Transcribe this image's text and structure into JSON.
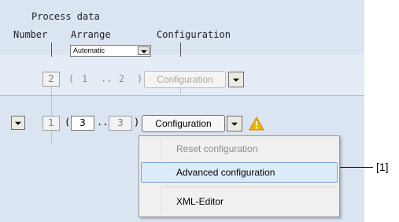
{
  "header": {
    "process_data": "Process data",
    "number": "Number",
    "arrange": "Arrange",
    "configuration": "Configuration"
  },
  "arrange_select": {
    "value": "Automatic"
  },
  "row1": {
    "number_value": "2",
    "range_open": "(",
    "range_min": "1",
    "range_sep": "..",
    "range_max": "2",
    "range_close": ")",
    "config_button": "Configuration"
  },
  "row2": {
    "number_value": "1",
    "range_open": "(",
    "range_min": "3",
    "range_sep": "..",
    "range_max": "3",
    "range_close": ")",
    "config_button": "Configuration"
  },
  "context_menu": {
    "items": [
      {
        "label": "Reset configuration",
        "enabled": false
      },
      {
        "label": "Advanced configuration",
        "highlighted": true
      },
      {
        "label": "XML-Editor"
      }
    ]
  },
  "callout": {
    "label": "[1]"
  },
  "icons": {
    "warning": "warning-icon",
    "dropdown": "chevron-down-icon"
  },
  "colors": {
    "panel_bg": "#dbe5f1",
    "highlight_bg": "#dcebfc",
    "highlight_border": "#7da2ce",
    "warning": "#f2b200"
  }
}
